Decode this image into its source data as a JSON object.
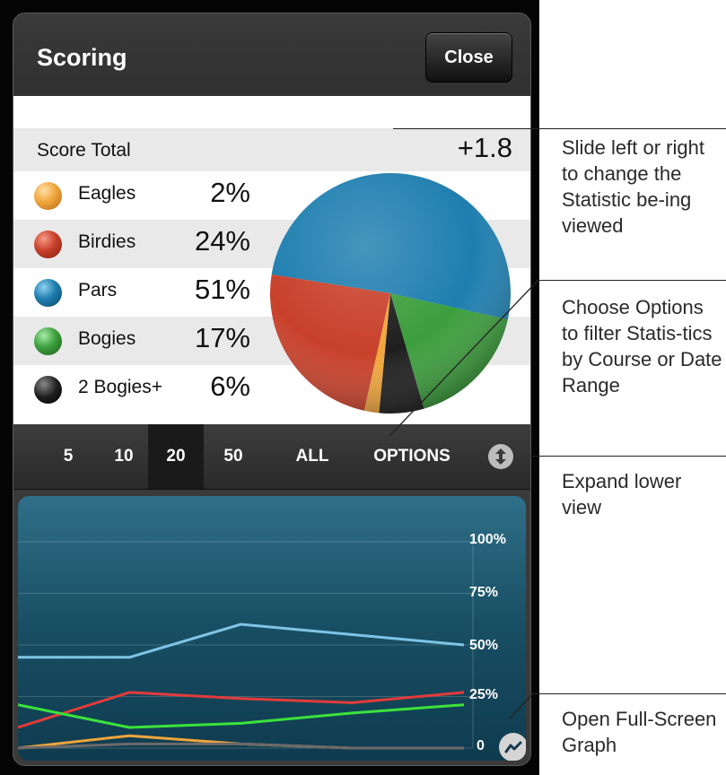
{
  "header": {
    "title": "Scoring",
    "close_label": "Close"
  },
  "score_total": {
    "label": "Score Total",
    "value": "+1.8"
  },
  "stats": [
    {
      "name": "Eagles",
      "pct": "2%",
      "percent": 2,
      "color": "#f0a53c"
    },
    {
      "name": "Birdies",
      "pct": "24%",
      "percent": 24,
      "color": "#c8402a"
    },
    {
      "name": "Pars",
      "pct": "51%",
      "percent": 51,
      "color": "#1e7eaf"
    },
    {
      "name": "Bogies",
      "pct": "17%",
      "percent": 17,
      "color": "#3c9e3c"
    },
    {
      "name": "2 Bogies+",
      "pct": "6%",
      "percent": 6,
      "color": "#1e1e1e"
    }
  ],
  "range_buttons": [
    {
      "label": "5"
    },
    {
      "label": "10"
    },
    {
      "label": "20",
      "selected": true
    },
    {
      "label": "50"
    },
    {
      "label": "ALL"
    },
    {
      "label": "OPTIONS"
    }
  ],
  "icons": {
    "expand": "expand-vertical-icon",
    "fullscreen": "graph-fullscreen-icon"
  },
  "chart_data": {
    "type": "line",
    "yticks": [
      "100%",
      "75%",
      "50%",
      "25%",
      "0"
    ],
    "ylim": [
      0,
      100
    ],
    "x": [
      0,
      1,
      2,
      3,
      4
    ],
    "series": [
      {
        "color": "#7ec4e6",
        "values": [
          44,
          44,
          60,
          55,
          50
        ]
      },
      {
        "color": "#e23b3b",
        "values": [
          10,
          27,
          24,
          22,
          27
        ]
      },
      {
        "color": "#3be23b",
        "values": [
          21,
          10,
          12,
          17,
          21
        ]
      },
      {
        "color": "#f0a53c",
        "values": [
          0,
          6,
          2,
          0,
          0
        ]
      },
      {
        "color": "#6a6a6a",
        "values": [
          0,
          2,
          2,
          0,
          0
        ]
      }
    ]
  },
  "callouts": [
    {
      "text": "Slide left or right to change the Statistic be-ing viewed"
    },
    {
      "text": "Choose Options to filter Statis-tics by Course or Date Range"
    },
    {
      "text": "Expand lower view"
    },
    {
      "text": "Open Full-Screen Graph"
    }
  ]
}
